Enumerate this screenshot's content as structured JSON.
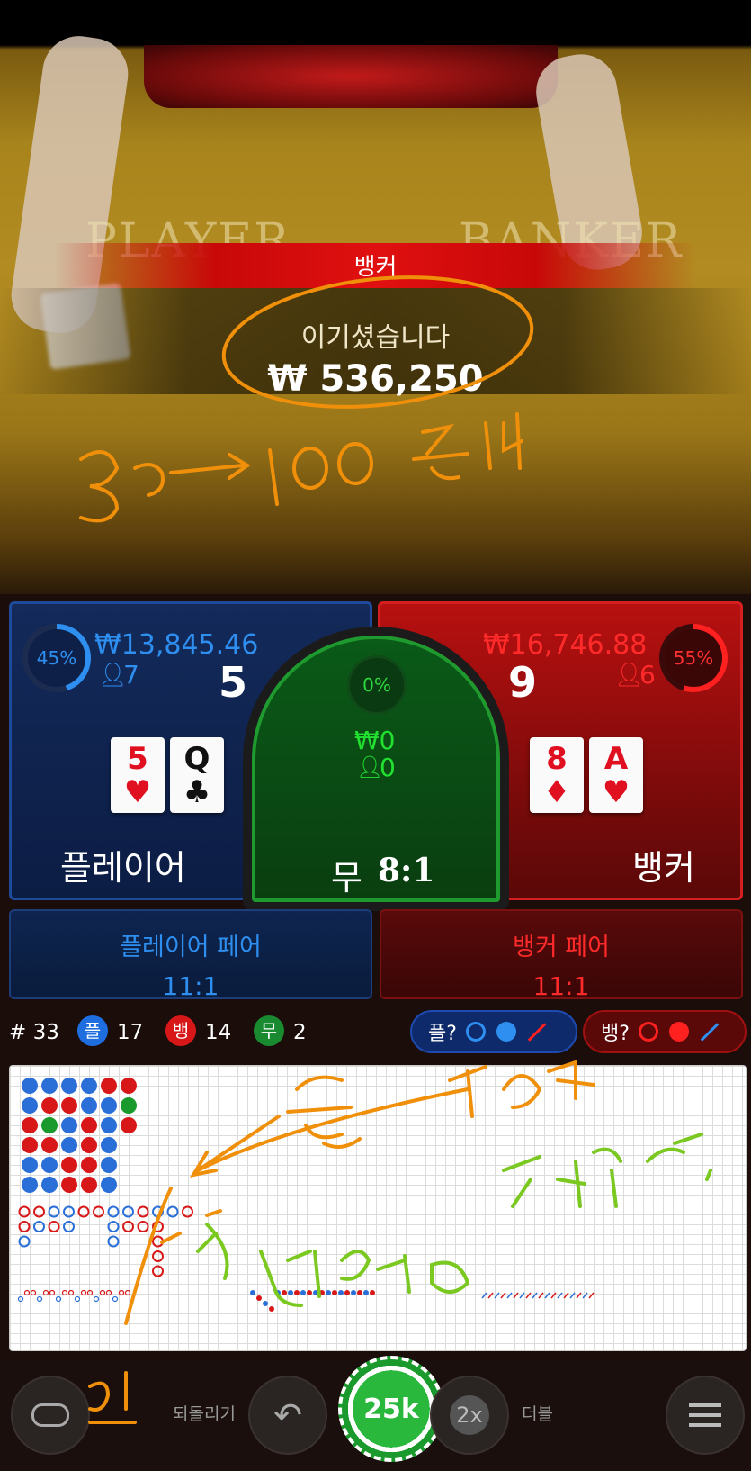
{
  "video": {
    "table_player": "PLAYER",
    "table_banker": "BANKER",
    "result_label": "뱅커",
    "win_message": "이기셨습니다",
    "win_amount": "₩ 536,250"
  },
  "player": {
    "percent": "45%",
    "bet_total": "₩13,845.46",
    "bettors": "7",
    "score": "5",
    "cards": [
      {
        "rank": "5",
        "suit": "♥",
        "color": "red"
      },
      {
        "rank": "Q",
        "suit": "♣",
        "color": "black"
      }
    ],
    "label": "플레이어"
  },
  "tie": {
    "percent": "0%",
    "bet_total": "₩0",
    "bettors": "0",
    "label": "무",
    "odds": "8:1"
  },
  "banker": {
    "percent": "55%",
    "bet_total": "₩16,746.88",
    "bettors": "6",
    "score": "9",
    "cards": [
      {
        "rank": "8",
        "suit": "♦",
        "color": "red"
      },
      {
        "rank": "A",
        "suit": "♥",
        "color": "red"
      }
    ],
    "label": "뱅커"
  },
  "pairs": {
    "player_label": "플레이어 페어",
    "player_odds": "11:1",
    "banker_label": "뱅커 페어",
    "banker_odds": "11:1"
  },
  "stats": {
    "round": "# 33",
    "player_icon": "플",
    "player_count": "17",
    "banker_icon": "뱅",
    "banker_count": "14",
    "tie_icon": "무",
    "tie_count": "2",
    "ask_player": "플?",
    "ask_banker": "뱅?"
  },
  "bottom": {
    "undo_label": "되돌리기",
    "chip_value": "25k",
    "double_icon": "2x",
    "double_label": "더블"
  },
  "colors": {
    "player": "#2e8ff0",
    "banker": "#e01010",
    "tie": "#22c030"
  }
}
